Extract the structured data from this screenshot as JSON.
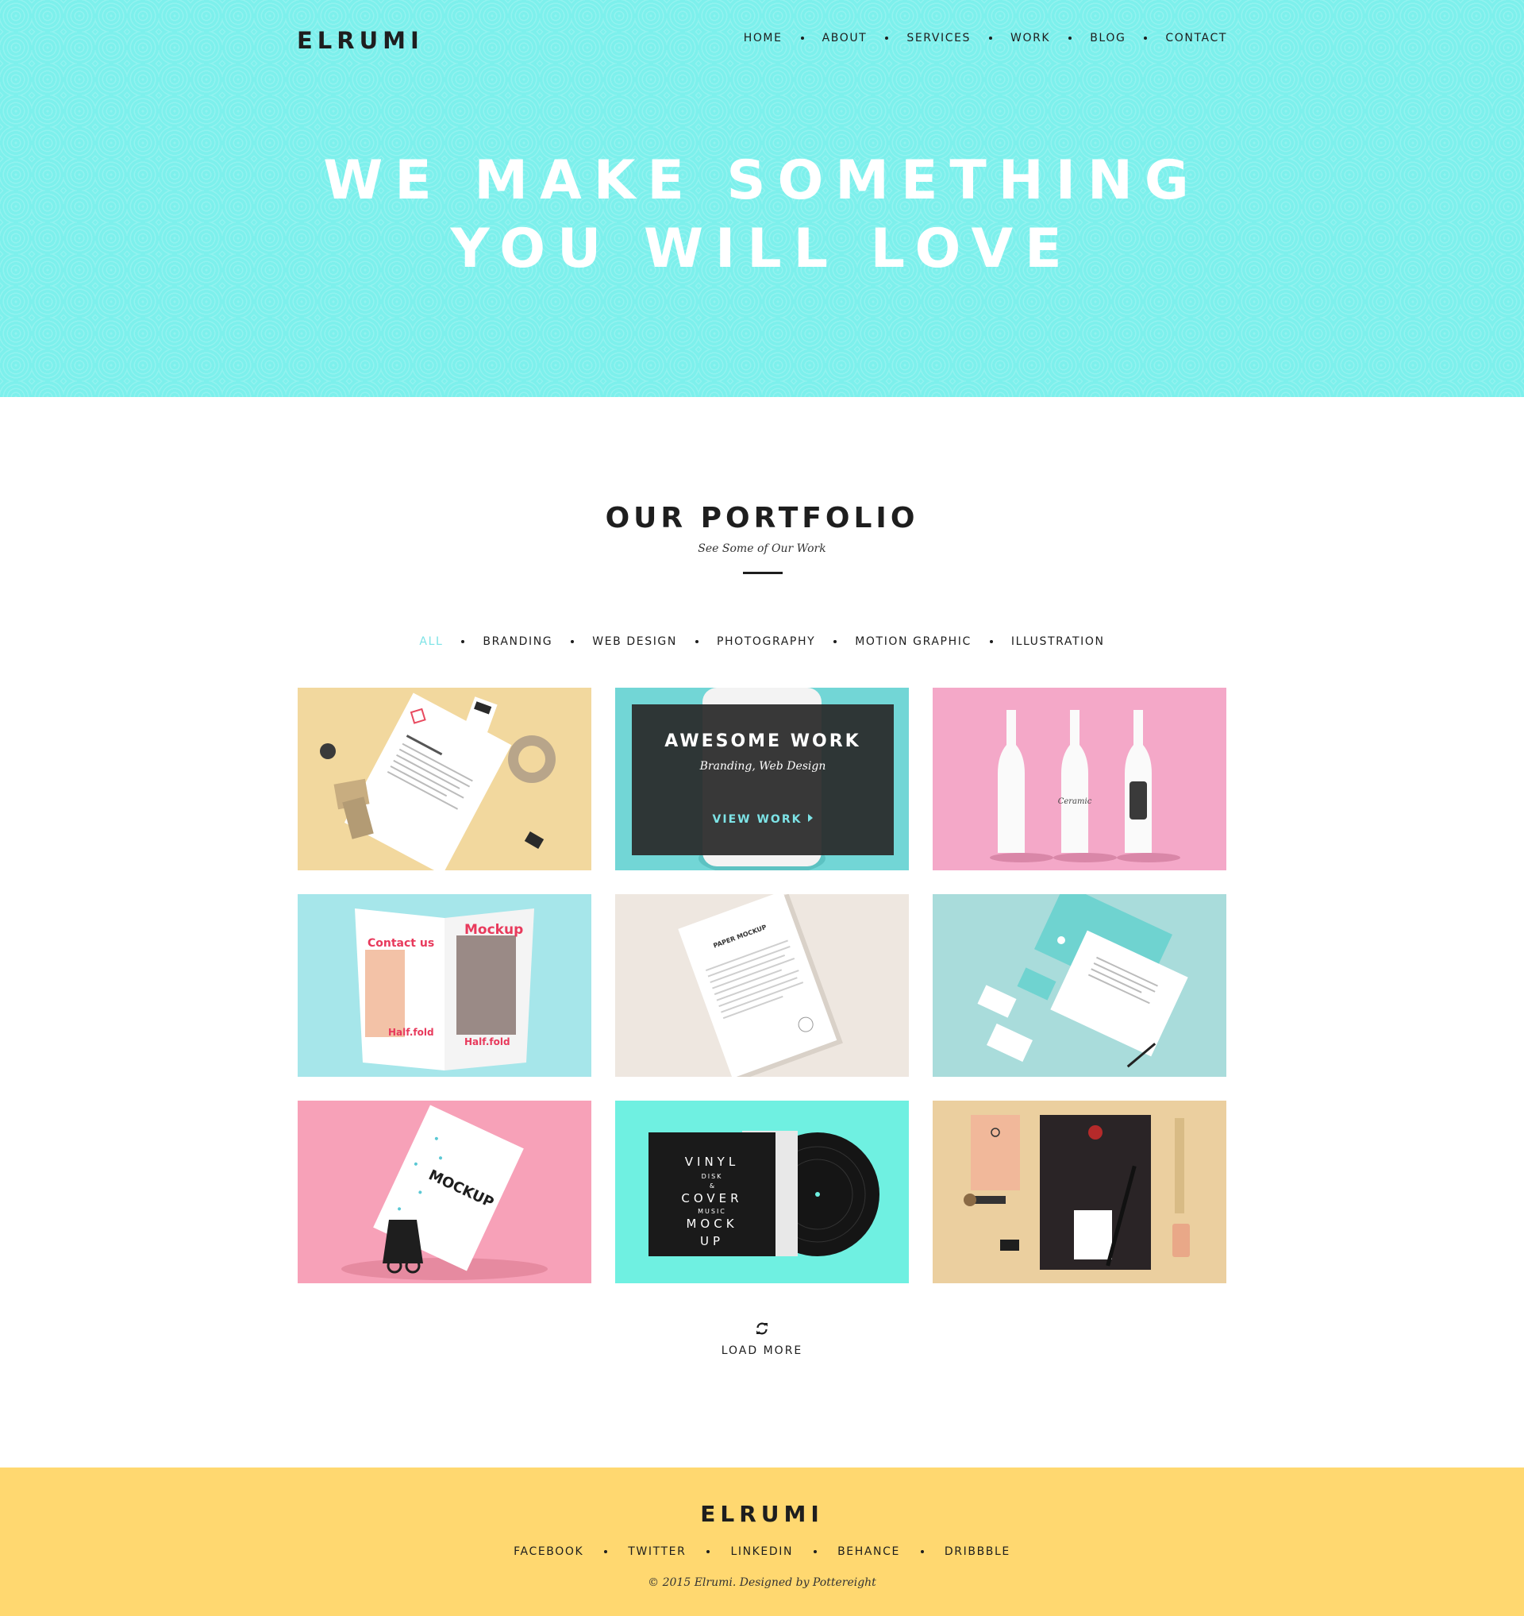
{
  "brand": {
    "name": "ELRUMI"
  },
  "nav": {
    "items": [
      {
        "label": "HOME"
      },
      {
        "label": "ABOUT"
      },
      {
        "label": "SERVICES"
      },
      {
        "label": "WORK"
      },
      {
        "label": "BLOG"
      },
      {
        "label": "CONTACT"
      }
    ]
  },
  "hero": {
    "line1": "WE MAKE SOMETHING",
    "line2": "YOU WILL LOVE",
    "background_color": "#7df0ec"
  },
  "portfolio": {
    "title": "OUR PORTFOLIO",
    "subtitle": "See Some of Our Work",
    "filters": [
      {
        "label": "ALL",
        "active": true
      },
      {
        "label": "BRANDING",
        "active": false
      },
      {
        "label": "WEB DESIGN",
        "active": false
      },
      {
        "label": "PHOTOGRAPHY",
        "active": false
      },
      {
        "label": "MOTION GRAPHIC",
        "active": false
      },
      {
        "label": "ILLUSTRATION",
        "active": false
      }
    ],
    "accent_color": "#7de3e6",
    "items": [
      {
        "name": "letterhead-stationery",
        "bg": "#f2d89e"
      },
      {
        "name": "mug-mockup",
        "bg": "#72d6d6",
        "overlay": {
          "title": "AWESOME WORK",
          "categories": "Branding, Web Design",
          "link": "VIEW WORK"
        }
      },
      {
        "name": "ceramic-bottles",
        "bg": "#f4a8c8",
        "bottle_text": "Ceramic"
      },
      {
        "name": "half-fold-brochure",
        "bg": "#a6e6ea",
        "brochure_text": {
          "left_head": "Contact us",
          "right_head": "Mockup",
          "left_foot": "Half.fold",
          "right_foot": "Half.fold"
        }
      },
      {
        "name": "paper-mockup",
        "bg": "#eee7e0",
        "paper_title": "PAPER MOCKUP"
      },
      {
        "name": "corporate-identity",
        "bg": "#a9dcdb"
      },
      {
        "name": "business-card-clip",
        "bg": "#f7a1b8",
        "card_text": "MOCKUP"
      },
      {
        "name": "vinyl-cover",
        "bg": "#6ff0e1",
        "cover_text": [
          "VINYL",
          "DISK",
          "&",
          "COVER",
          "MUSIC",
          "MOCK",
          "UP"
        ]
      },
      {
        "name": "envelope-stationery",
        "bg": "#ebcf9f"
      }
    ],
    "load_more": "LOAD MORE",
    "load_icon": "refresh-icon"
  },
  "footer": {
    "brand": "ELRUMI",
    "links": [
      {
        "label": "FACEBOOK"
      },
      {
        "label": "TWITTER"
      },
      {
        "label": "LINKEDIN"
      },
      {
        "label": "BEHANCE"
      },
      {
        "label": "DRIBBBLE"
      }
    ],
    "copyright": "© 2015 Elrumi. Designed by Pottereight",
    "background_color": "#ffd870"
  }
}
